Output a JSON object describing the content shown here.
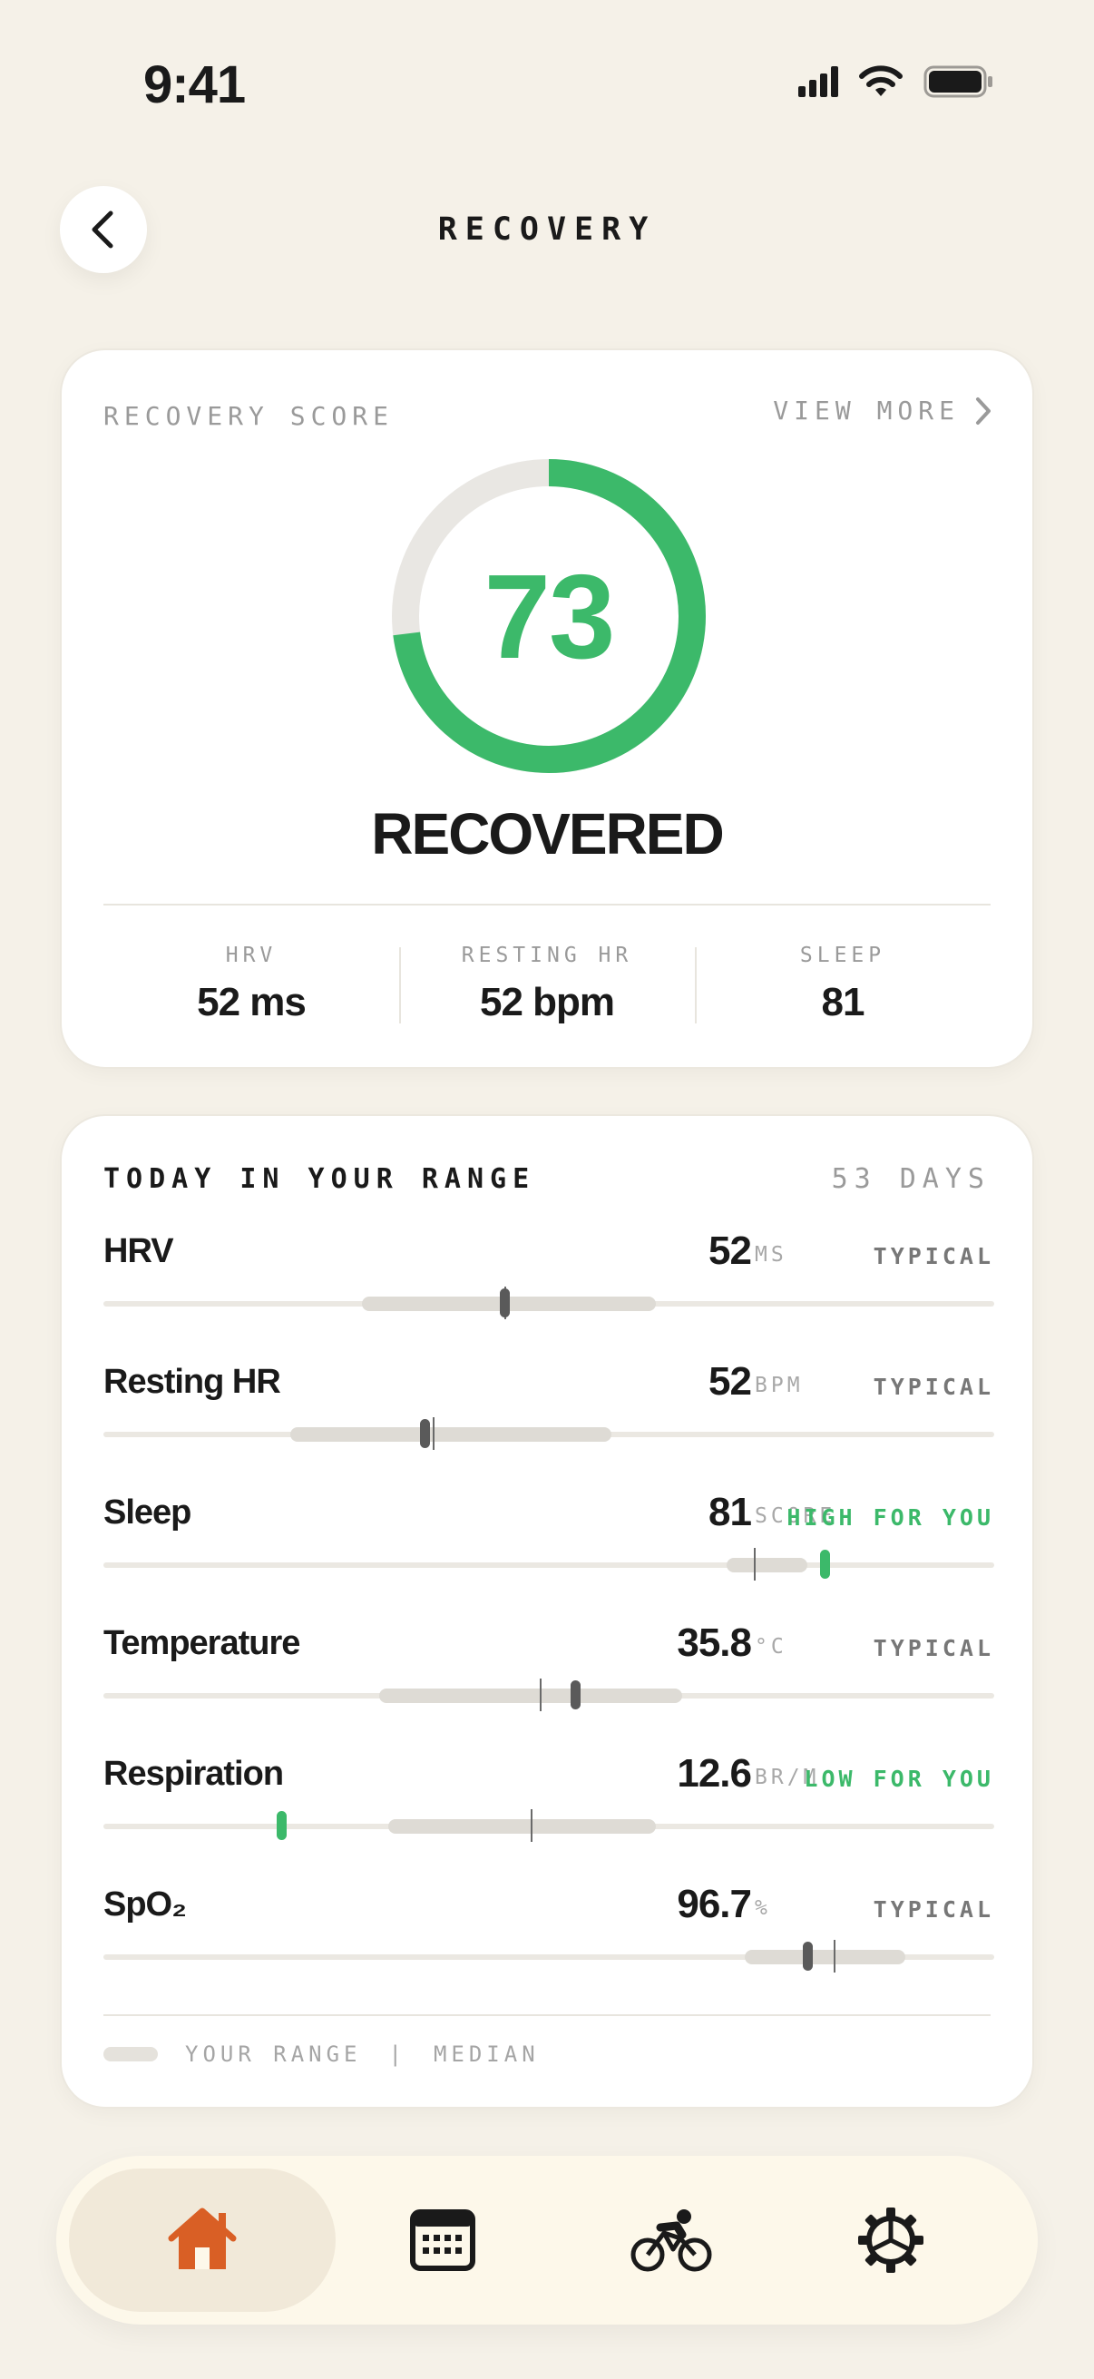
{
  "status_bar": {
    "time": "9:41"
  },
  "header": {
    "title": "RECOVERY"
  },
  "recovery": {
    "label": "RECOVERY SCORE",
    "view_more": "VIEW MORE",
    "score": "73",
    "score_fraction": 0.73,
    "status": "RECOVERED",
    "stats": [
      {
        "label": "HRV",
        "value": "52 ms"
      },
      {
        "label": "RESTING HR",
        "value": "52 bpm"
      },
      {
        "label": "SLEEP",
        "value": "81"
      }
    ]
  },
  "range": {
    "title": "TODAY IN YOUR RANGE",
    "days": "53 DAYS",
    "metrics": [
      {
        "name": "HRV",
        "value": "52",
        "unit": "MS",
        "flag": "TYPICAL",
        "range_lo": 0.29,
        "range_hi": 0.62,
        "median": 0.45,
        "today": 0.45
      },
      {
        "name": "Resting HR",
        "value": "52",
        "unit": "BPM",
        "flag": "TYPICAL",
        "range_lo": 0.21,
        "range_hi": 0.57,
        "median": 0.37,
        "today": 0.36
      },
      {
        "name": "Sleep",
        "value": "81",
        "unit": "SCORE",
        "flag": "HIGH FOR YOU",
        "range_lo": 0.7,
        "range_hi": 0.79,
        "median": 0.73,
        "today": 0.81
      },
      {
        "name": "Temperature",
        "value": "35.8",
        "unit": "°C",
        "flag": "TYPICAL",
        "range_lo": 0.31,
        "range_hi": 0.65,
        "median": 0.49,
        "today": 0.53
      },
      {
        "name": "Respiration",
        "value": "12.6",
        "unit": "BR/M",
        "flag": "LOW FOR YOU",
        "range_lo": 0.32,
        "range_hi": 0.62,
        "median": 0.48,
        "today": 0.2
      },
      {
        "name": "SpO₂",
        "value": "96.7",
        "unit": "%",
        "flag": "TYPICAL",
        "range_lo": 0.72,
        "range_hi": 0.9,
        "median": 0.82,
        "today": 0.79
      }
    ],
    "legend": {
      "range_label": "YOUR RANGE",
      "separator": "|",
      "median_label": "MEDIAN"
    }
  },
  "colors": {
    "background": "#f5f1e8",
    "accent_green": "#3cb96a",
    "accent_orange": "#d95f25",
    "text_dark": "#1a1a1a",
    "text_muted": "#9a9a9a"
  },
  "nav": {
    "items": [
      {
        "icon": "home-icon",
        "active": true
      },
      {
        "icon": "calendar-icon",
        "active": false
      },
      {
        "icon": "cycling-icon",
        "active": false
      },
      {
        "icon": "settings-icon",
        "active": false
      }
    ]
  }
}
